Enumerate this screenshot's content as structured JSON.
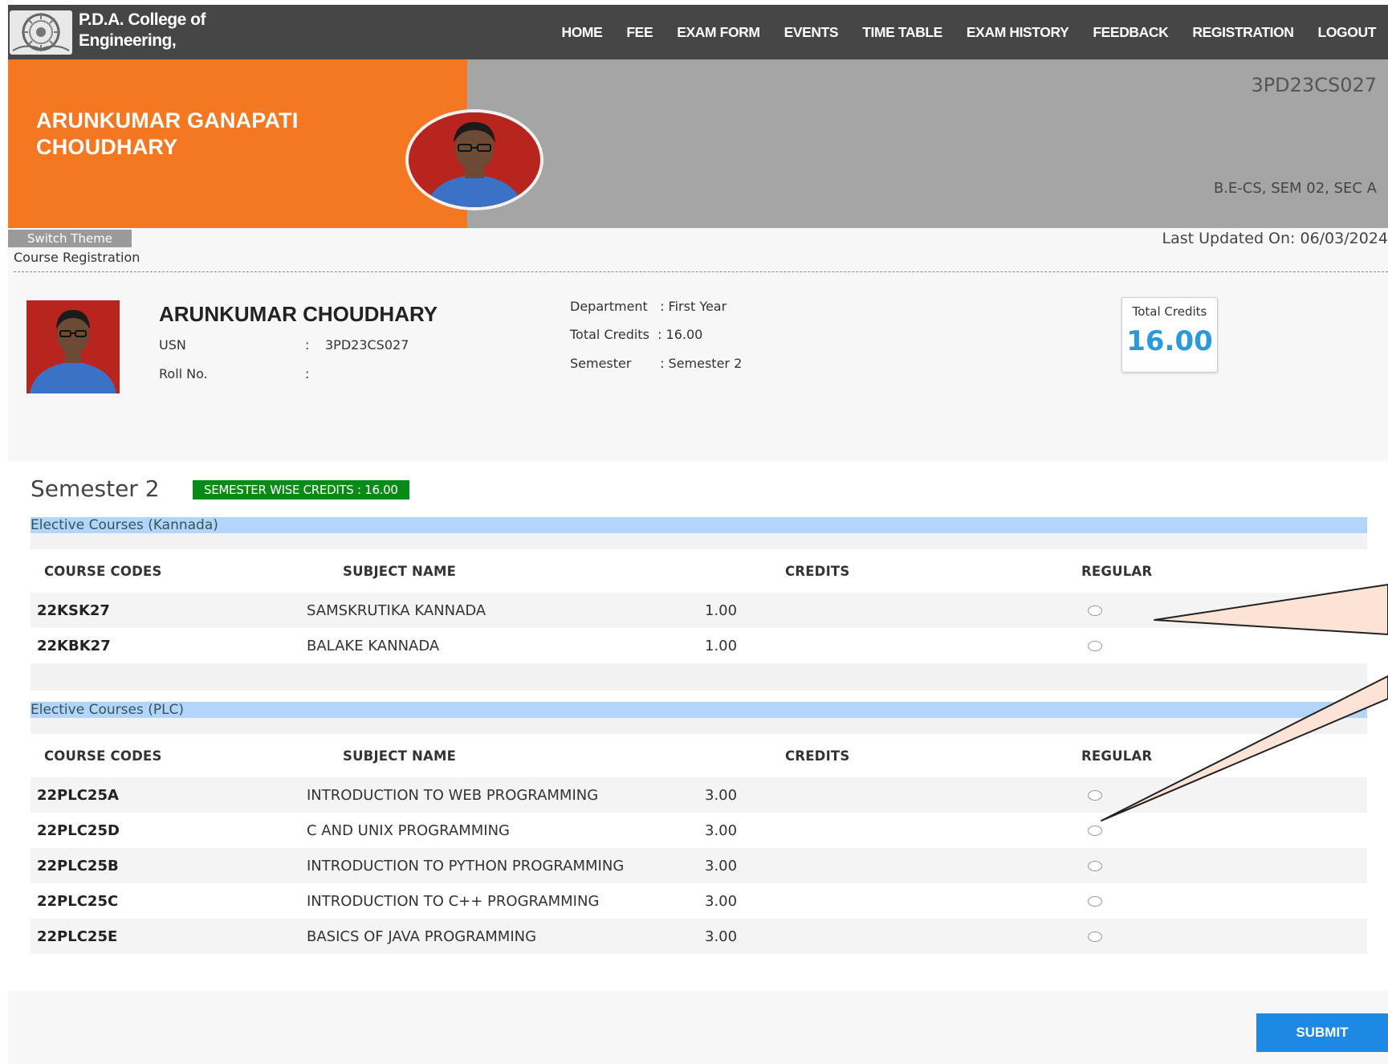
{
  "college": {
    "line1": "P.D.A. College of",
    "line2": "Engineering,"
  },
  "nav": [
    "HOME",
    "FEE",
    "EXAM FORM",
    "EVENTS",
    "TIME TABLE",
    "EXAM HISTORY",
    "FEEDBACK",
    "REGISTRATION",
    "LOGOUT"
  ],
  "hero": {
    "name_line1": "ARUNKUMAR GANAPATI",
    "name_line2": "CHOUDHARY",
    "usn": "3PD23CS027",
    "semester_info": "B.E-CS, SEM 02, SEC A"
  },
  "switch_theme": "Switch Theme",
  "breadcrumb": "Course Registration",
  "last_updated": "Last Updated On: 06/03/2024",
  "profile": {
    "name": "ARUNKUMAR CHOUDHARY",
    "usn_label": "USN",
    "usn_sep": ":",
    "usn_value": "3PD23CS027",
    "roll_label": "Roll No.",
    "roll_sep": ":",
    "roll_value": "",
    "department": "Department   : First Year",
    "total_credits": "Total Credits  : 16.00",
    "semester": "Semester       : Semester 2",
    "credits_box_label": "Total Credits",
    "credits_box_value": "16.00"
  },
  "courses": {
    "semester_title": "Semester 2",
    "semester_credits": "SEMESTER WISE CREDITS : 16.00",
    "headers": {
      "code": "COURSE CODES",
      "name": "SUBJECT NAME",
      "credits": "CREDITS",
      "regular": "REGULAR"
    },
    "sections": [
      {
        "title": "Elective Courses (Kannada)",
        "rows": [
          {
            "code": "22KSK27",
            "name": "SAMSKRUTIKA KANNADA",
            "credits": "1.00"
          },
          {
            "code": "22KBK27",
            "name": "BALAKE KANNADA",
            "credits": "1.00"
          }
        ]
      },
      {
        "title": "Elective Courses (PLC)",
        "rows": [
          {
            "code": "22PLC25A",
            "name": "INTRODUCTION TO WEB PROGRAMMING",
            "credits": "3.00"
          },
          {
            "code": "22PLC25D",
            "name": "C AND UNIX PROGRAMMING",
            "credits": "3.00"
          },
          {
            "code": "22PLC25B",
            "name": "INTRODUCTION TO PYTHON PROGRAMMING",
            "credits": "3.00"
          },
          {
            "code": "22PLC25C",
            "name": "INTRODUCTION TO C++ PROGRAMMING",
            "credits": "3.00"
          },
          {
            "code": "22PLC25E",
            "name": "BASICS OF JAVA PROGRAMMING",
            "credits": "3.00"
          }
        ]
      }
    ]
  },
  "submit_label": "SUBMIT",
  "colors": {
    "nav_bg": "#464646",
    "hero_orange": "#f47721",
    "hero_grey": "#a5a5a5",
    "badge_green": "#0a8a18",
    "section_blue": "#b3d4fb",
    "submit_blue": "#1e88e5",
    "credits_blue": "#2a9ad8",
    "callout_fill": "#fbe3d6"
  }
}
